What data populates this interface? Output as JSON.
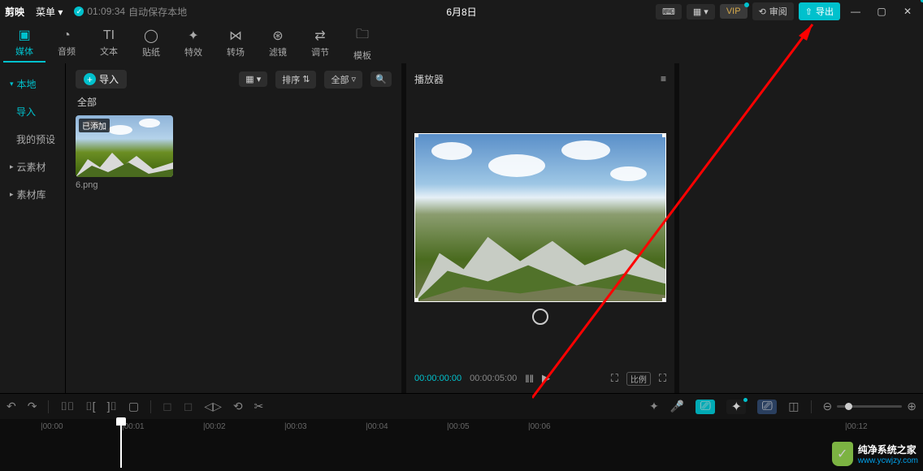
{
  "topbar": {
    "logo": "剪映",
    "menu": "菜单 ▾",
    "save_time": "01:09:34",
    "save_text": "自动保存本地",
    "title": "6月8日",
    "review": "审阅",
    "export": "导出",
    "vip": "VIP"
  },
  "tabs": [
    {
      "icon": "▣",
      "label": "媒体"
    },
    {
      "icon": "◔",
      "label": "音频"
    },
    {
      "icon": "TI",
      "label": "文本"
    },
    {
      "icon": "◯",
      "label": "贴纸"
    },
    {
      "icon": "✦",
      "label": "特效"
    },
    {
      "icon": "⋈",
      "label": "转场"
    },
    {
      "icon": "⊛",
      "label": "滤镜"
    },
    {
      "icon": "⇄",
      "label": "调节"
    },
    {
      "icon": "🗀",
      "label": "模板"
    }
  ],
  "leftnav": {
    "local": "本地",
    "import": "导入",
    "preset": "我的预设",
    "cloud": "云素材",
    "lib": "素材库"
  },
  "center": {
    "import_btn": "导入",
    "sort": "排序",
    "all": "全部",
    "all_label": "全部",
    "badge": "已添加",
    "filename": "6.png"
  },
  "player": {
    "title": "播放器",
    "cur": "00:00:00:00",
    "dur": "00:00:05:00",
    "ratio": "比例"
  },
  "ruler": [
    "|00:00",
    "|00:01",
    "|00:02",
    "|00:03",
    "|00:04",
    "|00:05",
    "|00:06",
    "|00:12"
  ],
  "watermark": {
    "name": "纯净系统之家",
    "url": "www.ycwjzy.com"
  }
}
